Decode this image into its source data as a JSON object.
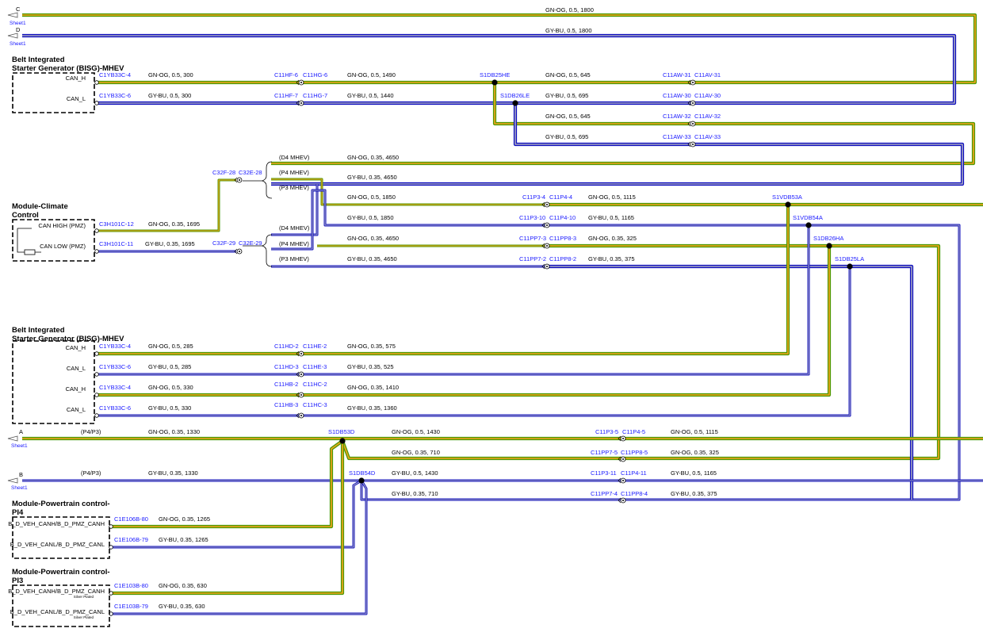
{
  "colors": {
    "gn_og_outer": "#4e9a06",
    "gn_og_inner": "#f5a31a",
    "gy_bu_outer": "#1010c0",
    "gy_bu_inner": "#a9a9c0",
    "label_blue": "#1a1aff",
    "connector_border": "#000000"
  },
  "sheet_refs": {
    "C": {
      "letter": "C",
      "sheet": "Sheet1"
    },
    "D": {
      "letter": "D",
      "sheet": "Sheet1"
    },
    "A": {
      "letter": "A",
      "sheet": "Sheet1"
    },
    "B": {
      "letter": "B",
      "sheet": "Sheet1"
    }
  },
  "modules": {
    "bisg1": {
      "title1": "Belt Integrated",
      "title2": "Starter Generator (BISG)-MHEV",
      "pin1": "CAN_H",
      "pin2": "CAN_L"
    },
    "climate": {
      "title1": "Module-Climate",
      "title2": "Control",
      "pin1": "CAN HIGH (PMZ)",
      "pin2": "CAN LOW (PMZ)"
    },
    "bisg2": {
      "title1": "Belt Integrated",
      "title2": "Starter Generator (BISG)-MHEV",
      "pin1": "CAN_H",
      "pin2": "CAN_L",
      "pin3": "CAN_H",
      "pin4": "CAN_L"
    },
    "pl4": {
      "title1": "Module-Powertrain control-",
      "title2": "PI4",
      "pin1": "B_D_VEH_CANH/B_D_PMZ_CANH",
      "pin2": "B_D_VEH_CANL/B_D_PMZ_CANL"
    },
    "pl3": {
      "title1": "Module-Powertrain control-",
      "title2": "PI3",
      "pin1": "B_D_VEH_CANH/B_D_PMZ_CANH",
      "pin2": "B_D_VEH_CANL/B_D_PMZ_CANL",
      "note": "Silver Plated"
    }
  },
  "labels": {
    "w_c": "GN-OG, 0.5, 1800",
    "w_d": "GY-BU, 0.5, 1800",
    "w1_a": "C1YB33C-4",
    "w1_b": "GN-OG, 0.5, 300",
    "w1_c": "C11HF-6",
    "w1_d": "C11HG-6",
    "w1_e": "GN-OG, 0.5, 1490",
    "w1_f": "S1DB25HE",
    "w1_g": "GN-OG, 0.5, 645",
    "w1_h": "C11AW-31",
    "w1_i": "C11AV-31",
    "w2_a": "C1YB33C-6",
    "w2_b": "GY-BU, 0.5, 300",
    "w2_c": "C11HF-7",
    "w2_d": "C11HG-7",
    "w2_e": "GY-BU, 0.5, 1440",
    "w2_f": "S1DB26LE",
    "w2_g": "GY-BU, 0.5, 695",
    "w2_h": "C11AW-30",
    "w2_i": "C11AV-30",
    "w3_a": "GN-OG, 0.5, 645",
    "w3_b": "C11AW-32",
    "w3_c": "C11AV-32",
    "w4_a": "GY-BU, 0.5, 695",
    "w4_b": "C11AW-33",
    "w4_c": "C11AV-33",
    "sw1_a": "C32F-28",
    "sw1_b": "C32E-28",
    "sw2_a": "C32F-29",
    "sw2_b": "C32E-29",
    "v_d4_1": "(D4 MHEV)",
    "v_p4_1": "(P4 MHEV)",
    "v_p3_1": "(P3 MHEV)",
    "v_d4_2": "(D4 MHEV)",
    "v_p4_2": "(P4 MHEV)",
    "v_p3_2": "(P3 MHEV)",
    "r1": "GN-OG, 0.35, 4650",
    "r2": "GY-BU, 0.35, 4650",
    "r3_a": "GN-OG, 0.5, 1850",
    "r3_b": "C11P3-4",
    "r3_c": "C11P4-4",
    "r3_d": "GN-OG, 0.5, 1115",
    "r3_e": "S1VDB53A",
    "r4_a": "GY-BU, 0.5, 1850",
    "r4_b": "C11P3-10",
    "r4_c": "C11P4-10",
    "r4_d": "GY-BU, 0.5, 1165",
    "r4_e": "S1VDB54A",
    "r5_a": "GN-OG, 0.35, 4650",
    "r5_b": "C11PP7-3",
    "r5_c": "C11PP8-3",
    "r5_d": "GN-OG, 0.35, 325",
    "r5_e": "S1DB26HA",
    "r6_a": "GY-BU, 0.35, 4650",
    "r6_b": "C11PP7-2",
    "r6_c": "C11PP8-2",
    "r6_d": "GY-BU, 0.35, 375",
    "r6_e": "S1DB25LA",
    "cl1_a": "C3H101C-12",
    "cl1_b": "GN-OG, 0.35, 1695",
    "cl2_a": "C3H101C-11",
    "cl2_b": "GY-BU, 0.35, 1695",
    "b1_a": "C1YB33C-4",
    "b1_b": "GN-OG, 0.5, 285",
    "b1_c": "C11HD-2",
    "b1_d": "C11HE-2",
    "b1_e": "GN-OG, 0.35, 575",
    "b2_a": "C1YB33C-6",
    "b2_b": "GY-BU, 0.5, 285",
    "b2_c": "C11HD-3",
    "b2_d": "C11HE-3",
    "b2_e": "GY-BU, 0.35, 525",
    "b3_a": "C1YB33C-4",
    "b3_b": "GN-OG, 0.5, 330",
    "b3_c": "C11HB-2",
    "b3_d": "C11HC-2",
    "b3_e": "GN-OG, 0.35, 1410",
    "b4_a": "C1YB33C-6",
    "b4_b": "GY-BU, 0.5, 330",
    "b4_c": "C11HB-3",
    "b4_d": "C11HC-3",
    "b4_e": "GY-BU, 0.35, 1360",
    "a_p": "(P4/P3)",
    "a_w": "GN-OG, 0.35, 1330",
    "a_s": "S1DB53D",
    "a_w2": "GN-OG, 0.5, 1430",
    "a_c1": "C11P3-5",
    "a_c2": "C11P4-5",
    "a_w3": "GN-OG, 0.5, 1115",
    "a2_w": "GN-OG, 0.35, 710",
    "a2_c1": "C11PP7-5",
    "a2_c2": "C11PP8-5",
    "a2_w3": "GN-OG, 0.35, 325",
    "b_p": "(P4/P3)",
    "b_w": "GY-BU, 0.35, 1330",
    "b_s": "S1DB54D",
    "b_w2": "GY-BU, 0.5, 1430",
    "b_c1": "C11P3-11",
    "b_c2": "C11P4-11",
    "b_w3": "GY-BU, 0.5, 1165",
    "b2_w": "GY-BU, 0.35, 710",
    "b2_c1": "C11PP7-4",
    "b2_c2": "C11PP8-4",
    "b2_w3": "GY-BU, 0.35, 375",
    "p4_1a": "C1E106B-80",
    "p4_1b": "GN-OG, 0.35, 1265",
    "p4_2a": "C1E106B-79",
    "p4_2b": "GY-BU, 0.35, 1265",
    "p3_1a": "C1E103B-80",
    "p3_1b": "GN-OG, 0.35, 630",
    "p3_2a": "C1E103B-79",
    "p3_2b": "GY-BU, 0.35, 630"
  }
}
